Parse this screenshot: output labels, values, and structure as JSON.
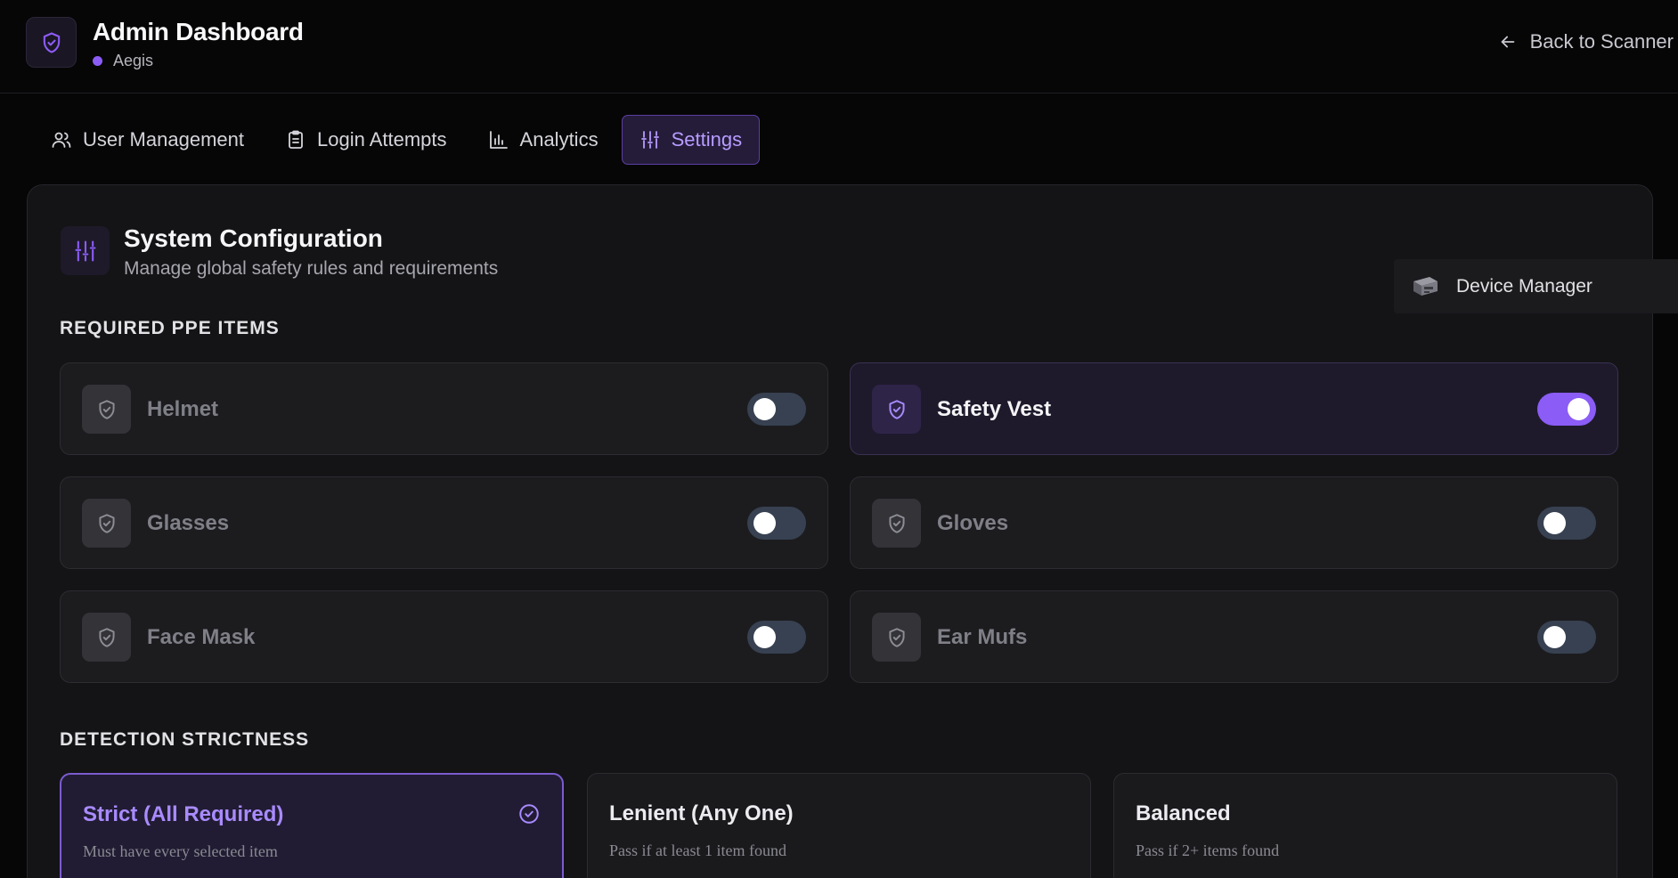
{
  "header": {
    "title": "Admin Dashboard",
    "subtitle": "Aegis",
    "back_label": "Back to Scanner",
    "logo_icon": "shield-check-icon"
  },
  "tabs": [
    {
      "label": "User Management",
      "icon": "users-icon",
      "active": false
    },
    {
      "label": "Login Attempts",
      "icon": "clipboard-icon",
      "active": false
    },
    {
      "label": "Analytics",
      "icon": "bar-chart-icon",
      "active": false
    },
    {
      "label": "Settings",
      "icon": "sliders-icon",
      "active": true
    }
  ],
  "section": {
    "title": "System Configuration",
    "subtitle": "Manage global safety rules and requirements"
  },
  "device_manager": {
    "label": "Device Manager",
    "icon": "device-icon"
  },
  "ppe": {
    "heading": "REQUIRED PPE ITEMS",
    "items": [
      {
        "name": "Helmet",
        "enabled": false
      },
      {
        "name": "Safety Vest",
        "enabled": true
      },
      {
        "name": "Glasses",
        "enabled": false
      },
      {
        "name": "Gloves",
        "enabled": false
      },
      {
        "name": "Face Mask",
        "enabled": false
      },
      {
        "name": "Ear Mufs",
        "enabled": false
      }
    ]
  },
  "strictness": {
    "heading": "DETECTION STRICTNESS",
    "modes": [
      {
        "title": "Strict (All Required)",
        "desc": "Must have every selected item",
        "selected": true
      },
      {
        "title": "Lenient (Any One)",
        "desc": "Pass if at least 1 item found",
        "selected": false
      },
      {
        "title": "Balanced",
        "desc": "Pass if 2+ items found",
        "selected": false
      }
    ]
  },
  "colors": {
    "accent": "#8b5cf6",
    "accent_text": "#a98bff",
    "background": "#060607",
    "panel": "#141416",
    "toggle_off": "#374151"
  }
}
